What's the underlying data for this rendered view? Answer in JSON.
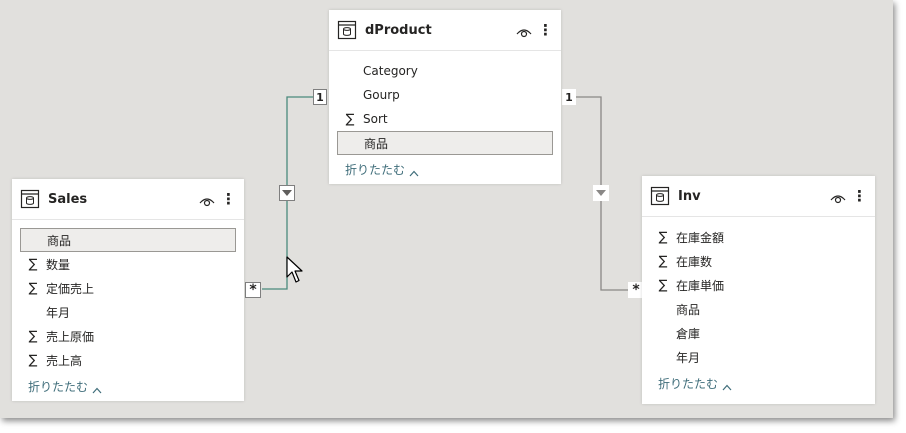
{
  "tables": {
    "dproduct": {
      "name": "dProduct",
      "fields": [
        {
          "label": "Category",
          "aggregate": false
        },
        {
          "label": "Gourp",
          "aggregate": false
        },
        {
          "label": "Sort",
          "aggregate": true
        },
        {
          "label": "商品",
          "aggregate": false,
          "selected": true
        }
      ],
      "collapse_label": "折りたたむ"
    },
    "sales": {
      "name": "Sales",
      "fields": [
        {
          "label": "商品",
          "aggregate": false,
          "selected": true
        },
        {
          "label": "数量",
          "aggregate": true
        },
        {
          "label": "定価売上",
          "aggregate": true
        },
        {
          "label": "年月",
          "aggregate": false
        },
        {
          "label": "売上原価",
          "aggregate": true
        },
        {
          "label": "売上高",
          "aggregate": true
        }
      ],
      "collapse_label": "折りたたむ"
    },
    "inv": {
      "name": "Inv",
      "fields": [
        {
          "label": "在庫金額",
          "aggregate": true
        },
        {
          "label": "在庫数",
          "aggregate": true
        },
        {
          "label": "在庫単価",
          "aggregate": true
        },
        {
          "label": "商品",
          "aggregate": false
        },
        {
          "label": "倉庫",
          "aggregate": false
        },
        {
          "label": "年月",
          "aggregate": false
        }
      ],
      "collapse_label": "折りたたむ"
    }
  },
  "relationships": [
    {
      "from": "Sales",
      "to": "dProduct",
      "from_cardinality": "*",
      "to_cardinality": "1",
      "highlighted": true
    },
    {
      "from": "Inv",
      "to": "dProduct",
      "from_cardinality": "*",
      "to_cardinality": "1",
      "highlighted": false
    }
  ],
  "symbols": {
    "sigma": "∑"
  },
  "colors": {
    "canvas": "#e1e0dd",
    "highlight_line": "#4a8a7c",
    "line": "#8a8886",
    "link_text": "#3f6d7a"
  }
}
